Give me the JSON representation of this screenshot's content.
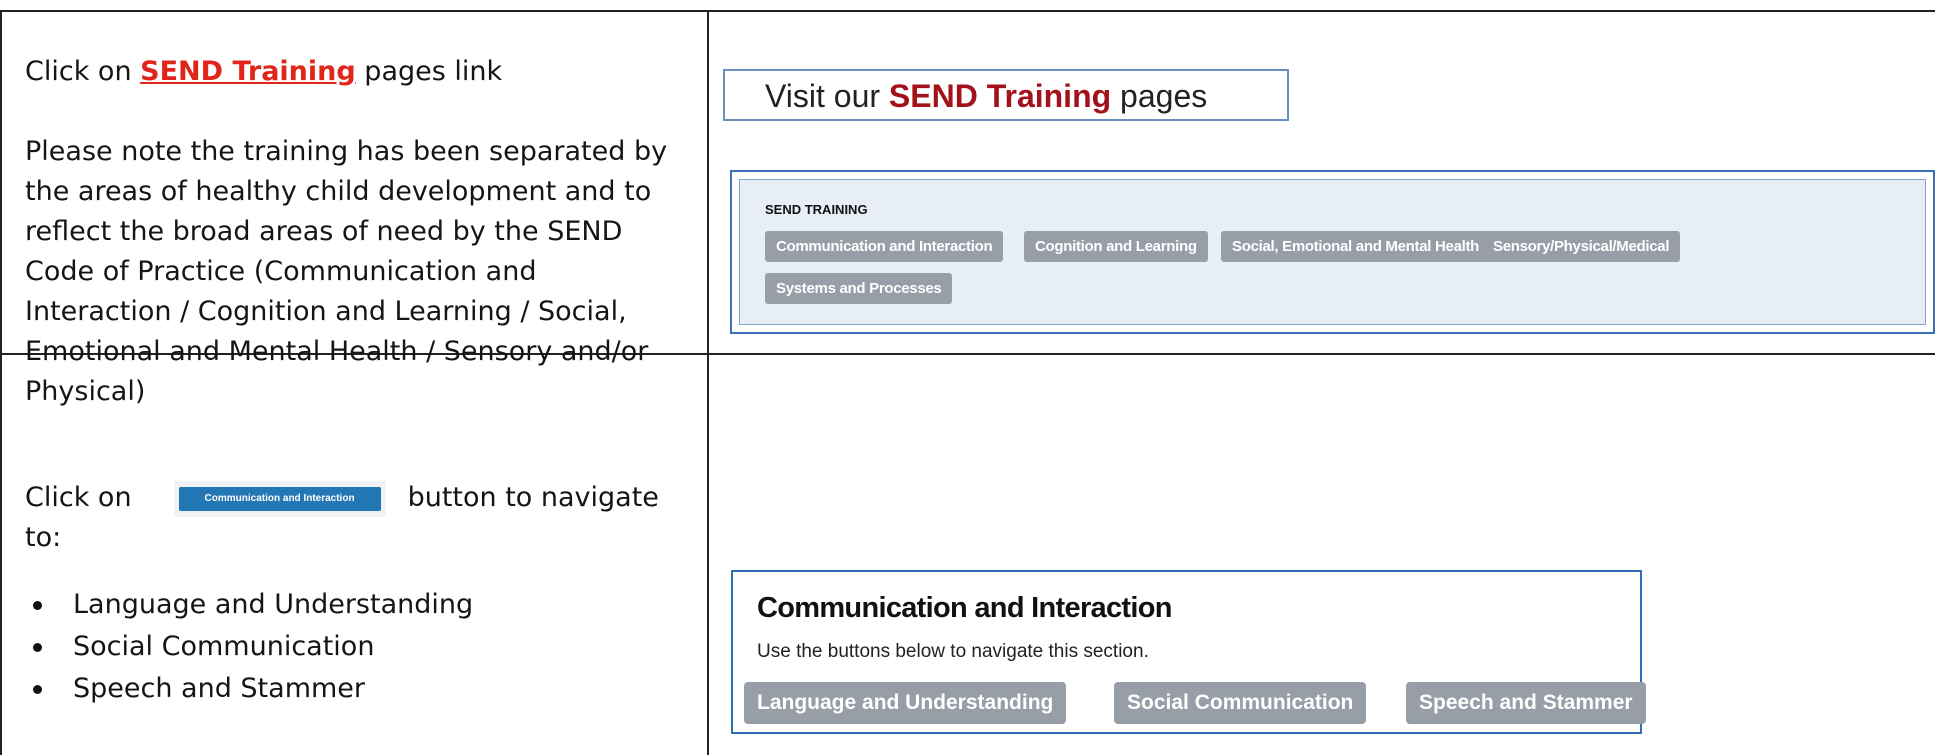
{
  "row1": {
    "instruction_prefix": "Click on ",
    "instruction_link": "SEND Training",
    "instruction_suffix": " pages link",
    "note": "Please note the training has been separated by the areas of healthy child development and to reflect the broad areas of need by the SEND Code of Practice (Communication and Interaction / Cognition and Learning / Social, Emotional and Mental Health / Sensory and/or Physical)",
    "visit_prefix": "Visit our ",
    "visit_link": "SEND Training",
    "visit_suffix": " pages",
    "panel": {
      "title": "SEND TRAINING",
      "buttons": [
        "Communication and Interaction",
        "Cognition and Learning",
        "Social, Emotional and Mental Health",
        "Sensory/Physical/Medical",
        "Systems and Processes"
      ]
    }
  },
  "row2": {
    "instruction_prefix": "Click on",
    "inline_button_label": "Communication and Interaction",
    "instruction_suffix": "button to navigate",
    "instruction_line2": "to:",
    "bullets": [
      "Language and Understanding",
      "Social Communication",
      "Speech and Stammer"
    ],
    "section": {
      "title": "Communication and Interaction",
      "subtitle": "Use the buttons below to navigate this section.",
      "buttons": [
        "Language and Understanding",
        "Social Communication",
        "Speech and Stammer"
      ]
    }
  },
  "colors": {
    "link_red": "#e0261b",
    "dark_red": "#a3121a",
    "tag_grey": "#989ea8",
    "panel_blue": "#3c6fb5",
    "button_blue": "#2377b4"
  }
}
